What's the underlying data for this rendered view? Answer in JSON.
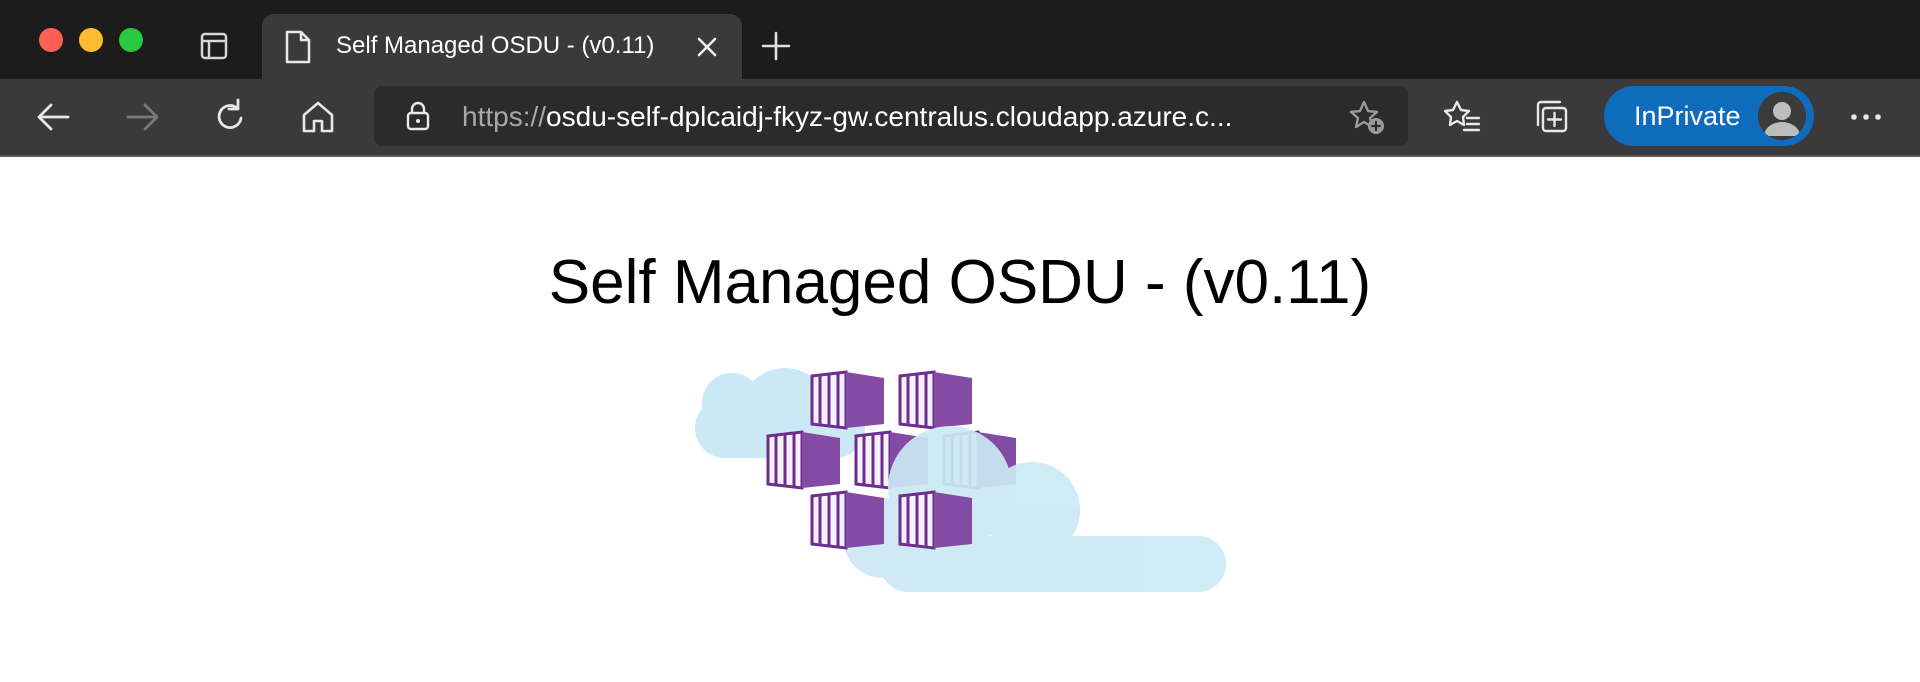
{
  "browser": {
    "tab": {
      "title": "Self Managed OSDU - (v0.11)"
    },
    "address_bar": {
      "url_scheme": "https://",
      "url_host": "osdu-self-dplcaidj-fkyz-gw.centralus.cloudapp.azure.c..."
    },
    "profile": {
      "label": "InPrivate"
    },
    "colors": {
      "tab_bar": "#1c1c1c",
      "toolbar": "#3a3a3a",
      "inprivate_badge": "#0f6cbd"
    }
  },
  "page": {
    "heading": "Self Managed OSDU - (v0.11)",
    "logo": {
      "icon": "azure-kubernetes-service-logo",
      "cloud_color": "#cbe9f5",
      "container_color": "#7a3f9d"
    }
  }
}
